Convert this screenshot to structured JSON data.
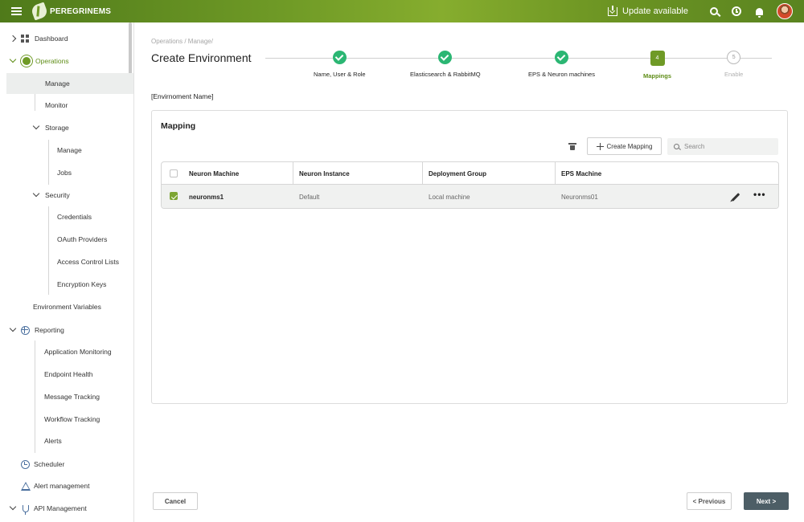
{
  "header": {
    "brand": "PEREGRINEMS",
    "update_label": "Update available",
    "icons": [
      "hamburger-icon",
      "logo-icon",
      "download-icon",
      "search-icon",
      "history-icon",
      "bell-icon",
      "avatar"
    ]
  },
  "sidebar": {
    "dashboard": "Dashboard",
    "operations": "Operations",
    "manage": "Manage",
    "monitor": "Monitor",
    "storage": "Storage",
    "storage_manage": "Manage",
    "jobs": "Jobs",
    "security": "Security",
    "credentials": "Credentials",
    "oauth": "OAuth Providers",
    "acl": "Access Control Lists",
    "encryption": "Encryption Keys",
    "env_vars": "Environment Variables",
    "reporting": "Reporting",
    "app_monitoring": "Application Monitoring",
    "endpoint_health": "Endpoint Health",
    "message_tracking": "Message Tracking",
    "workflow_tracking": "Workflow Tracking",
    "alerts": "Alerts",
    "scheduler": "Scheduler",
    "alert_mgmt": "Alert management",
    "api_mgmt": "API Management"
  },
  "main": {
    "breadcrumb": "Operations / Manage/",
    "title": "Create Environment",
    "env_name": "[Envirnoment Name]",
    "steps": [
      {
        "label": "Name, User & Role",
        "state": "done"
      },
      {
        "label": "Elasticsearch & RabbitMQ",
        "state": "done"
      },
      {
        "label": "EPS & Neuron machines",
        "state": "done"
      },
      {
        "label": "Mappings",
        "number": "4",
        "state": "current"
      },
      {
        "label": "Enable",
        "number": "5",
        "state": "pending"
      }
    ],
    "card": {
      "title": "Mapping",
      "create_label": "Create Mapping",
      "search_placeholder": "Search",
      "columns": [
        "Neuron Machine",
        "Neuron Instance",
        "Deployment Group",
        "EPS Machine"
      ],
      "rows": [
        {
          "checked": true,
          "neuron_machine": "neuronms1",
          "neuron_instance": "Default",
          "deployment_group": "Local machine",
          "eps_machine": "Neuronms01"
        }
      ]
    },
    "footer": {
      "cancel": "Cancel",
      "previous": "< Previous",
      "next": "Next >"
    }
  },
  "colors": {
    "brand_green": "#6f9a26",
    "done_green": "#2bb673",
    "next_button": "#4d5e66"
  }
}
